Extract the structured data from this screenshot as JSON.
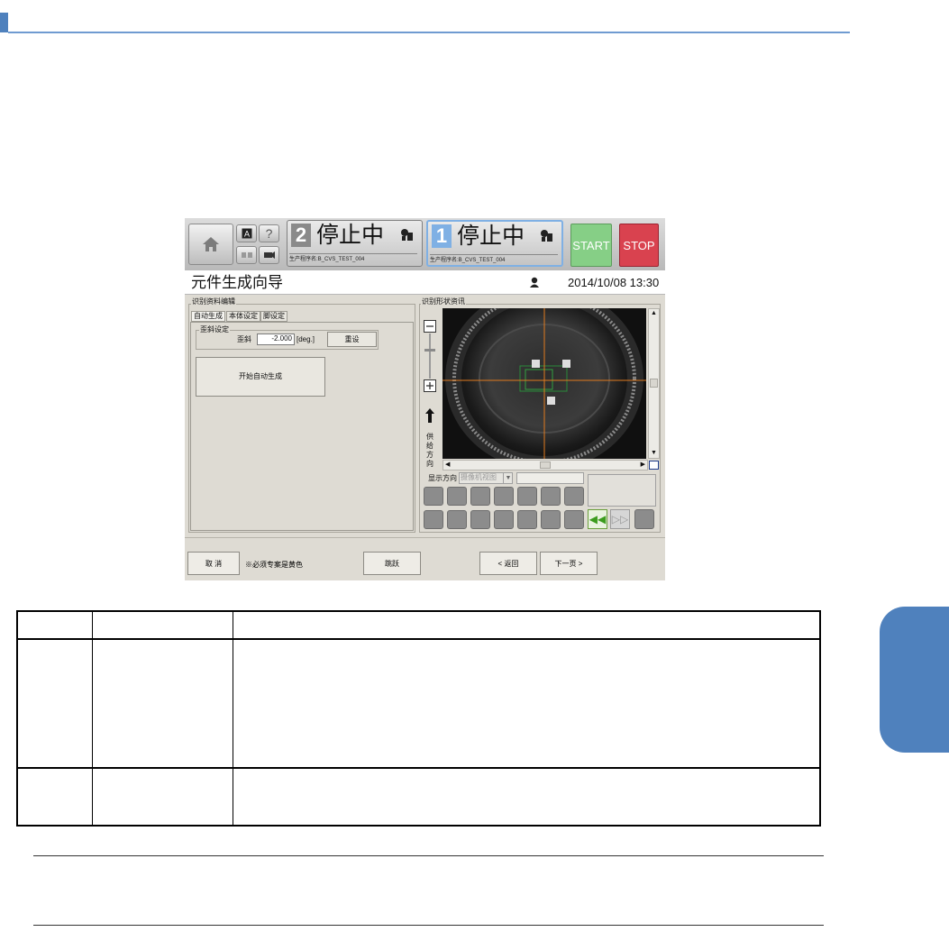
{
  "app": {
    "lane2": {
      "number": "2",
      "status": "停止中",
      "program": "生产程序名:B_CVS_TEST_004"
    },
    "lane1": {
      "number": "1",
      "status": "停止中",
      "program": "生产程序名:B_CVS_TEST_004"
    },
    "start_label": "START",
    "stop_label": "STOP",
    "title": "元件生成向导",
    "datetime": "2014/10/08 13:30",
    "left_group_label": "识别资料编辑",
    "tabs": [
      "自动生成",
      "本体设定",
      "脚设定"
    ],
    "tilt_group_label": "歪斜设定",
    "tilt_label": "歪斜",
    "tilt_value": "-2.000",
    "tilt_unit": "[deg.]",
    "reset_label": "重设",
    "auto_gen_label": "开始自动生成",
    "right_group_label": "识别形状资讯",
    "supply_direction_label": "供给方向",
    "display_direction_label": "显示方向",
    "display_direction_value": "摄像机视图",
    "cancel_label": "取 消",
    "note": "※必须专案是黄色",
    "jump_label": "跳跃",
    "back_label": "< 返回",
    "next_label": "下一页 >"
  },
  "colors": {
    "accent": "#4f81bd",
    "start": "#86cf86",
    "stop": "#d9424f",
    "crosshair": "#e07a1e",
    "lane1_number_bg": "#7fb0e4",
    "lane2_number_bg": "#8a8a8a"
  },
  "icons": [
    "home-icon",
    "auto-icon",
    "help-icon",
    "operator-icon",
    "camera-icon",
    "lane-icon",
    "user-icon",
    "zoom-out-icon",
    "zoom-in-icon",
    "arrow-up-icon",
    "rewind-icon",
    "fast-forward-icon"
  ]
}
